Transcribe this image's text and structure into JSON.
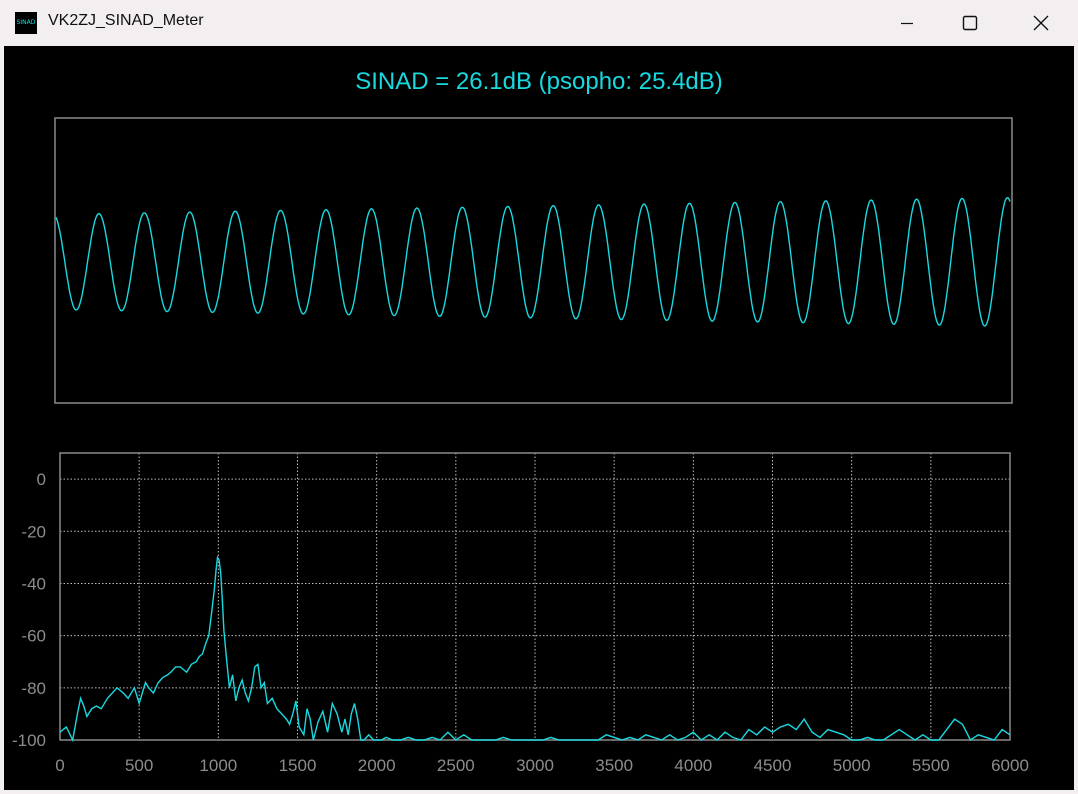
{
  "window": {
    "title": "VK2ZJ_SINAD_Meter",
    "icon": "sinad-app-icon",
    "icon_text": "SINAD",
    "controls": [
      "minimize-icon",
      "maximize-icon",
      "close-icon"
    ]
  },
  "readout": {
    "text": "SINAD = 26.1dB (psopho: 25.4dB)"
  },
  "colors": {
    "trace": "#19d9e0",
    "background": "#000000",
    "frame": "#8a8a8a",
    "grid": "#bdbdbd",
    "tick_label": "#8c8c8c"
  },
  "chart_data": [
    {
      "type": "line",
      "panel": "waveform",
      "title": "",
      "xlabel": "",
      "ylabel": "",
      "cycles": 21,
      "amplitude_start": 0.34,
      "amplitude_end": 0.46,
      "grid": false
    },
    {
      "type": "line",
      "panel": "spectrum",
      "title": "",
      "xlabel": "",
      "ylabel": "",
      "xlim": [
        0,
        6000
      ],
      "ylim": [
        -100,
        10
      ],
      "xticks": [
        0,
        500,
        1000,
        1500,
        2000,
        2500,
        3000,
        3500,
        4000,
        4500,
        5000,
        5500,
        6000
      ],
      "yticks": [
        0,
        -20,
        -40,
        -60,
        -80,
        -100
      ],
      "grid": true,
      "x": [
        0,
        40,
        80,
        110,
        130,
        150,
        170,
        200,
        230,
        260,
        300,
        330,
        360,
        400,
        430,
        470,
        500,
        520,
        540,
        560,
        590,
        620,
        650,
        680,
        700,
        730,
        760,
        780,
        800,
        830,
        860,
        880,
        900,
        920,
        940,
        960,
        975,
        985,
        995,
        1005,
        1015,
        1025,
        1035,
        1050,
        1070,
        1090,
        1110,
        1130,
        1150,
        1170,
        1190,
        1210,
        1230,
        1250,
        1270,
        1290,
        1310,
        1340,
        1370,
        1400,
        1430,
        1450,
        1470,
        1490,
        1510,
        1540,
        1560,
        1580,
        1600,
        1630,
        1660,
        1690,
        1720,
        1750,
        1780,
        1800,
        1820,
        1840,
        1860,
        1880,
        1900,
        1920,
        1950,
        1980,
        2000,
        2030,
        2060,
        2100,
        2150,
        2200,
        2250,
        2300,
        2350,
        2400,
        2450,
        2500,
        2550,
        2600,
        2650,
        2700,
        2750,
        2800,
        2850,
        2900,
        2950,
        3000,
        3050,
        3100,
        3150,
        3200,
        3250,
        3300,
        3350,
        3400,
        3450,
        3500,
        3550,
        3600,
        3650,
        3700,
        3750,
        3800,
        3850,
        3900,
        3950,
        4000,
        4050,
        4100,
        4150,
        4200,
        4250,
        4300,
        4350,
        4400,
        4450,
        4500,
        4550,
        4600,
        4650,
        4700,
        4750,
        4800,
        4850,
        4900,
        4950,
        5000,
        5050,
        5100,
        5150,
        5200,
        5250,
        5300,
        5350,
        5400,
        5450,
        5500,
        5550,
        5600,
        5650,
        5700,
        5750,
        5800,
        5850,
        5900,
        5950,
        6000
      ],
      "values": [
        -97,
        -95,
        -100,
        -90,
        -84,
        -87,
        -91,
        -88,
        -87,
        -88,
        -84,
        -82,
        -80,
        -82,
        -84,
        -80,
        -86,
        -82,
        -78,
        -80,
        -82,
        -78,
        -76,
        -75,
        -74,
        -72,
        -72,
        -73,
        -74,
        -71,
        -70,
        -68,
        -67,
        -63,
        -60,
        -50,
        -42,
        -35,
        -30,
        -31,
        -36,
        -46,
        -58,
        -68,
        -80,
        -75,
        -85,
        -80,
        -77,
        -82,
        -85,
        -80,
        -72,
        -71,
        -80,
        -78,
        -86,
        -84,
        -88,
        -90,
        -92,
        -94,
        -90,
        -85,
        -95,
        -98,
        -88,
        -92,
        -100,
        -93,
        -89,
        -97,
        -86,
        -90,
        -97,
        -92,
        -98,
        -90,
        -86,
        -92,
        -100,
        -100,
        -98,
        -100,
        -100,
        -100,
        -99,
        -100,
        -100,
        -99,
        -100,
        -100,
        -99,
        -100,
        -97,
        -100,
        -98,
        -100,
        -100,
        -100,
        -100,
        -99,
        -100,
        -100,
        -100,
        -100,
        -100,
        -99,
        -100,
        -100,
        -100,
        -100,
        -100,
        -100,
        -98,
        -99,
        -100,
        -99,
        -100,
        -98,
        -99,
        -100,
        -98,
        -100,
        -99,
        -97,
        -100,
        -98,
        -100,
        -97,
        -99,
        -100,
        -96,
        -98,
        -95,
        -97,
        -95,
        -94,
        -96,
        -92,
        -97,
        -99,
        -96,
        -97,
        -98,
        -100,
        -100,
        -99,
        -100,
        -100,
        -98,
        -96,
        -98,
        -100,
        -98,
        -100,
        -100,
        -96,
        -92,
        -94,
        -100,
        -98,
        -99,
        -100,
        -96,
        -98,
        -97,
        -100,
        -99,
        -96,
        -94
      ]
    }
  ]
}
